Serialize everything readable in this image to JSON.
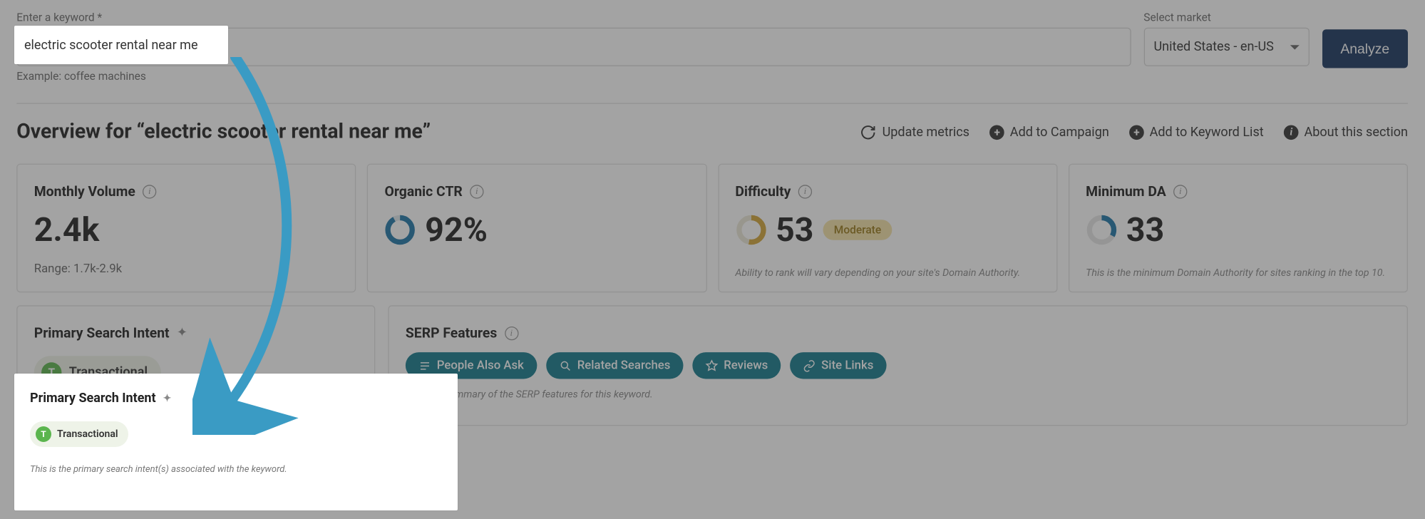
{
  "search": {
    "keyword_label": "Enter a keyword *",
    "keyword_value": "electric scooter rental near me",
    "example_hint": "Example: coffee machines",
    "market_label": "Select market",
    "market_value": "United States - en-US",
    "analyze_button": "Analyze"
  },
  "overview": {
    "title": "Overview for “electric scooter rental near me”",
    "actions": {
      "update": "Update metrics",
      "add_campaign": "Add to Campaign",
      "add_list": "Add to Keyword List",
      "about": "About this section"
    }
  },
  "metrics": {
    "volume": {
      "title": "Monthly Volume",
      "value": "2.4k",
      "range": "Range: 1.7k-2.9k"
    },
    "ctr": {
      "title": "Organic CTR",
      "value": "92%",
      "pct": 92
    },
    "difficulty": {
      "title": "Difficulty",
      "value": "53",
      "pct": 53,
      "badge": "Moderate",
      "note": "Ability to rank will vary depending on your site's Domain Authority."
    },
    "min_da": {
      "title": "Minimum DA",
      "value": "33",
      "pct": 33,
      "note": "This is the minimum Domain Authority for sites ranking in the top 10."
    }
  },
  "intent": {
    "title": "Primary Search Intent",
    "pill_letter": "T",
    "pill_label": "Transactional",
    "note": "This is the primary search intent(s) associated with the keyword."
  },
  "serp": {
    "title": "SERP Features",
    "features": [
      "People Also Ask",
      "Related Searches",
      "Reviews",
      "Site Links"
    ],
    "note": "This is a summary of the SERP features for this keyword."
  },
  "chart_data": [
    {
      "type": "donut_stat",
      "label": "Organic CTR",
      "value": 92,
      "max": 100,
      "colors": [
        "#1f77a8",
        "#e2e2e2"
      ]
    },
    {
      "type": "donut_stat",
      "label": "Difficulty",
      "value": 53,
      "max": 100,
      "colors": [
        "#d4a63a",
        "#e8e8e8"
      ]
    },
    {
      "type": "donut_stat",
      "label": "Minimum DA",
      "value": 33,
      "max": 100,
      "colors": [
        "#1f77a8",
        "#e8e8e8"
      ]
    }
  ]
}
